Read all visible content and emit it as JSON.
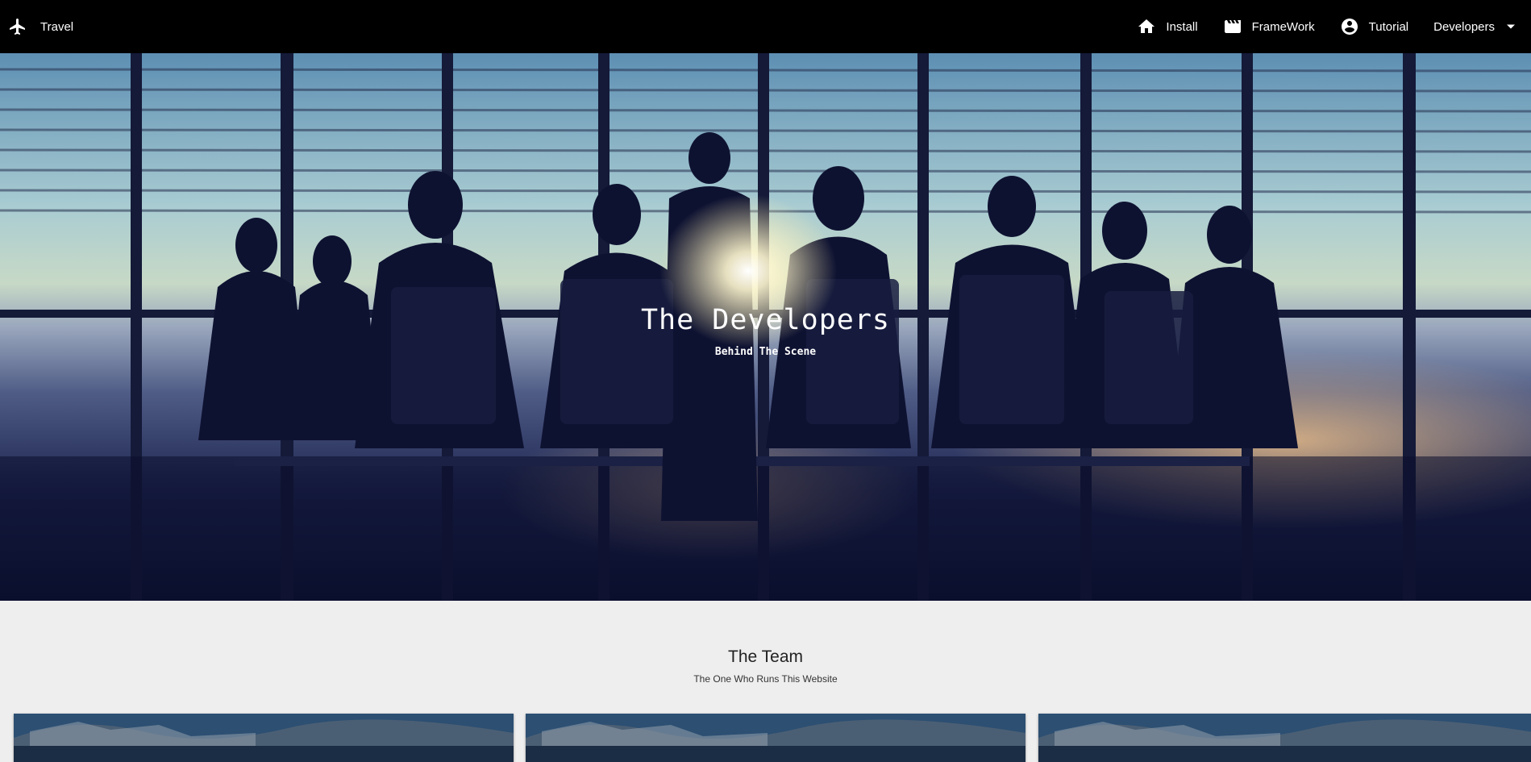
{
  "navbar": {
    "brand": {
      "icon": "airplane-icon",
      "label": "Travel"
    },
    "items": [
      {
        "icon": "home-icon",
        "label": "Install"
      },
      {
        "icon": "movie-clapper-icon",
        "label": "FrameWork"
      },
      {
        "icon": "account-circle-icon",
        "label": "Tutorial"
      },
      {
        "icon": "caret-down-icon",
        "label": "Developers"
      }
    ]
  },
  "hero": {
    "title": "The Developers",
    "subtitle": "Behind The Scene"
  },
  "team": {
    "title": "The Team",
    "subtitle": "The One Who Runs This Website",
    "cards": [
      {
        "image": "mountain-landscape"
      },
      {
        "image": "mountain-landscape"
      },
      {
        "image": "mountain-landscape"
      }
    ]
  },
  "colors": {
    "navbar_bg": "#000000",
    "page_bg": "#eeeeee",
    "hero_text": "#ffffff"
  }
}
